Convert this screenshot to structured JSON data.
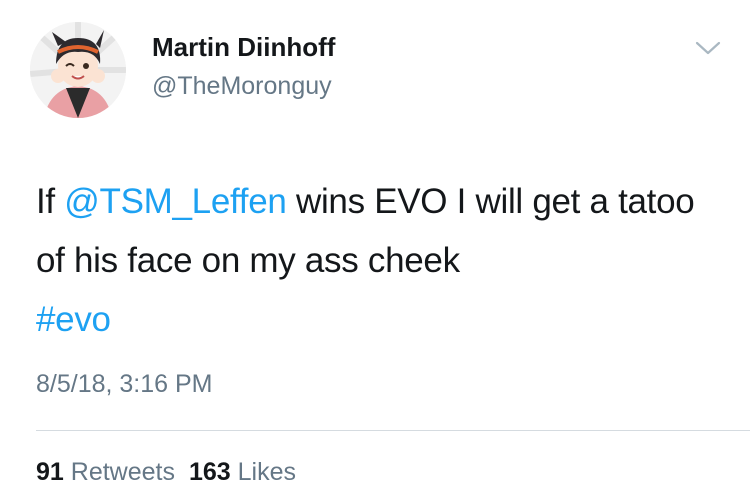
{
  "user": {
    "display_name": "Martin Diinhoff",
    "handle": "@TheMoronguy"
  },
  "tweet": {
    "text_before_mention": "If ",
    "mention": "@TSM_Leffen",
    "text_after_mention": " wins EVO I will get a tatoo of his face on my ass cheek",
    "hashtag": "#evo",
    "timestamp": "8/5/18, 3:16 PM"
  },
  "stats": {
    "retweets_count": "91",
    "retweets_label": "Retweets",
    "likes_count": "163",
    "likes_label": "Likes"
  },
  "colors": {
    "link": "#1da1f2",
    "secondary_text": "#657786",
    "primary_text": "#14171a",
    "divider": "#d5dbe0"
  },
  "icons": {
    "menu": "chevron-down-icon",
    "avatar": "avatar-image"
  }
}
